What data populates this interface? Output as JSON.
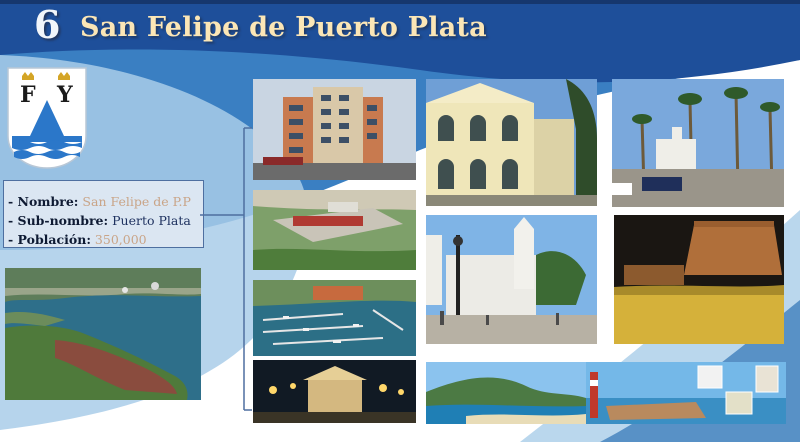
{
  "slide": {
    "number": "6",
    "title": "San Felipe de Puerto Plata"
  },
  "coat_of_arms": {
    "letter_left": "F",
    "letter_right": "Y"
  },
  "info": {
    "rows": [
      {
        "key": "- Nombre:",
        "value": "San Felipe de P.P"
      },
      {
        "key": "- Sub-nombre:",
        "value": "Puerto Plata"
      },
      {
        "key": "- Población:",
        "value": "350,000"
      }
    ]
  },
  "colors": {
    "header_band": "#1e4f9a",
    "accent_blue": "#2f74b5",
    "light_blue": "#a9cde9",
    "title_text": "#fbe6b6"
  }
}
